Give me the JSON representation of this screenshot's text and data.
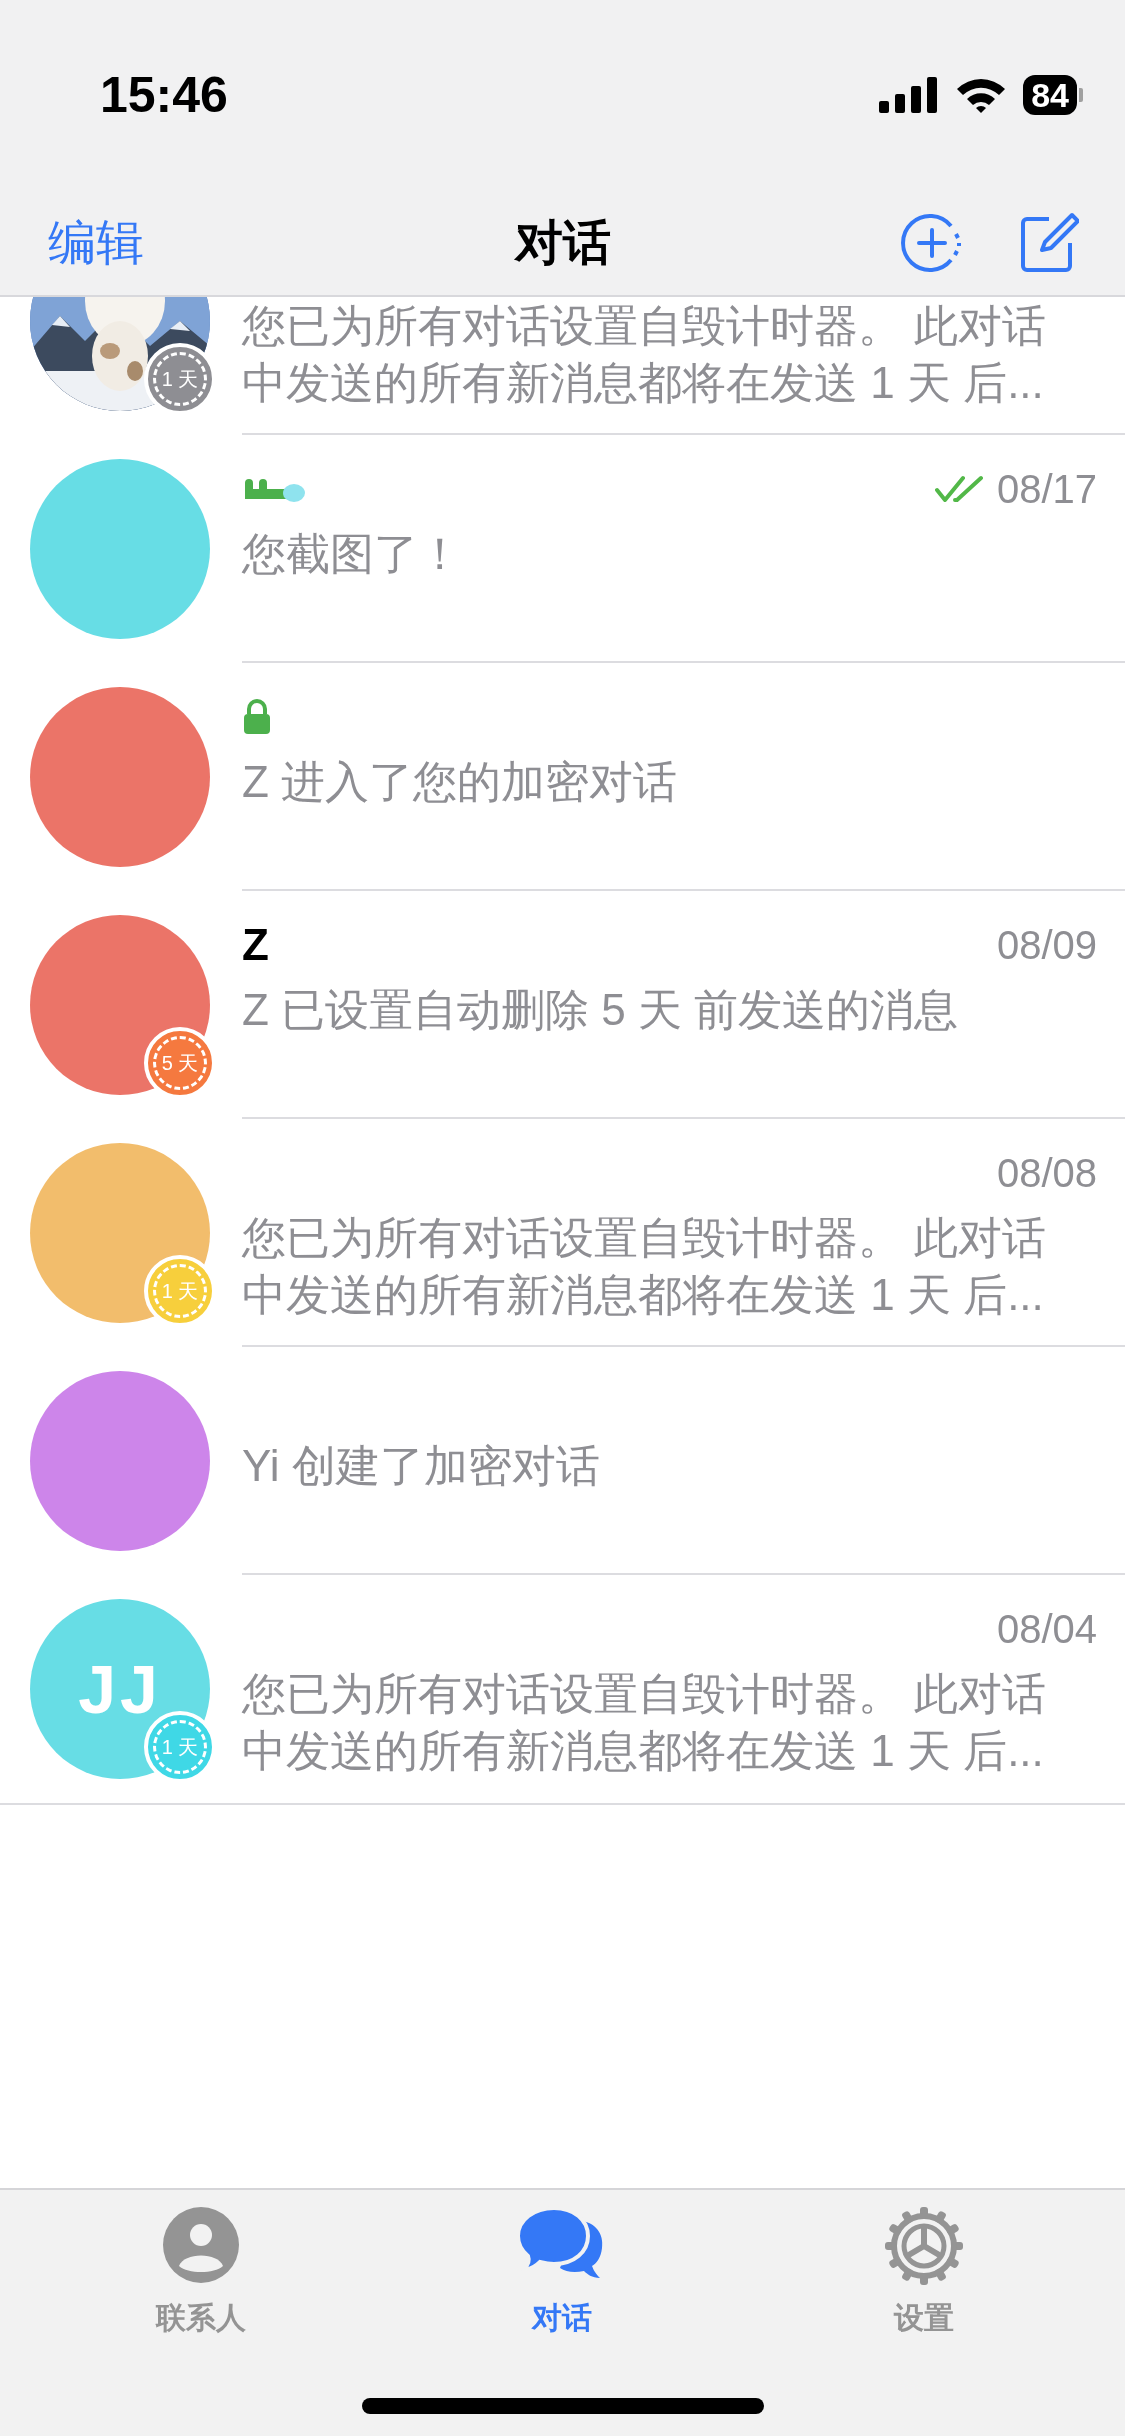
{
  "status_bar": {
    "time": "15:46",
    "battery": "84"
  },
  "nav": {
    "edit": "编辑",
    "title": "对话"
  },
  "chats": [
    {
      "timer": {
        "label": "1 天",
        "color": "#8e8e93"
      },
      "message": "您已为所有对话设置自毁计时器。 此对话中发送的所有新消息都将在发送 1 天 后..."
    },
    {
      "avatar": {
        "kind": "plain",
        "color": "#67dde5"
      },
      "name_icon": {
        "kind": "mark"
      },
      "read": true,
      "date": "08/17",
      "message": "您截图了！"
    },
    {
      "avatar": {
        "kind": "plain",
        "color": "#eb7468"
      },
      "name_icon": {
        "kind": "lock"
      },
      "message": "Z 进入了您的加密对话"
    },
    {
      "avatar": {
        "kind": "plain",
        "color": "#eb7468"
      },
      "name": "Z",
      "date": "08/09",
      "timer": {
        "label": "5 天",
        "color": "#f5793f"
      },
      "message": "Z 已设置自动删除 5 天 前发送的消息"
    },
    {
      "avatar": {
        "kind": "plain",
        "color": "#f2bd6c"
      },
      "date": "08/08",
      "timer": {
        "label": "1 天",
        "color": "#f7cf3c"
      },
      "message": "您已为所有对话设置自毁计时器。 此对话中发送的所有新消息都将在发送 1 天 后..."
    },
    {
      "avatar": {
        "kind": "plain",
        "color": "#cd85ea"
      },
      "message": "Yi 创建了加密对话"
    },
    {
      "avatar": {
        "kind": "plain",
        "color": "#67dde5",
        "initials": "JJ"
      },
      "date": "08/04",
      "timer": {
        "label": "1 天",
        "color": "#3fd8e6"
      },
      "message": "您已为所有对话设置自毁计时器。 此对话中发送的所有新消息都将在发送 1 天 后..."
    }
  ],
  "tabs": [
    {
      "label": "联系人",
      "kind": "contacts",
      "selected": false
    },
    {
      "label": "对话",
      "kind": "chats",
      "selected": true
    },
    {
      "label": "设置",
      "kind": "settings",
      "selected": false
    }
  ]
}
